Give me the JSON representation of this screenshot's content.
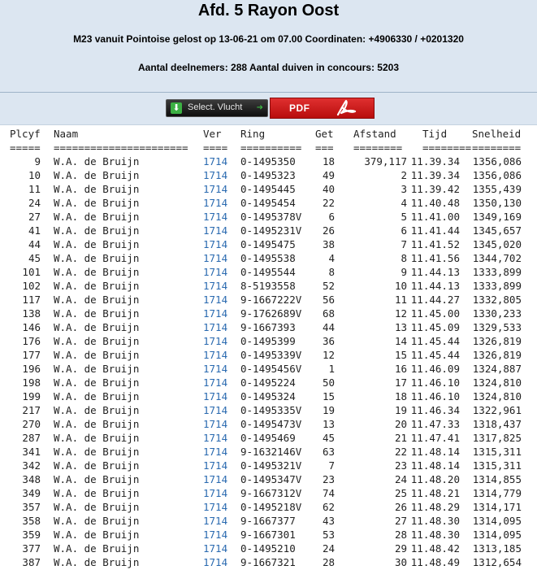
{
  "header": {
    "title": "Afd. 5 Rayon Oost",
    "subtitle": "M23 vanuit Pointoise gelost op 13-06-21 om 07.00 Coordinaten: +4906330 / +0201320",
    "participants": "Aantal deelnemers: 288 Aantal duiven in concours: 5203"
  },
  "toolbar": {
    "select_label": "Select. Vlucht",
    "pdf_label": "PDF",
    "select_icon": "download-icon",
    "pdf_icon": "adobe-acrobat-icon"
  },
  "colors": {
    "header_bg": "#dce6f1",
    "link": "#2a6ab0",
    "pdf_red": "#d01f1f"
  },
  "columns": [
    "Plcyf",
    "Naam",
    "Ver",
    "Ring",
    "Get",
    "Afstand",
    "Tijd",
    "Snelheid"
  ],
  "separators": [
    "=====",
    "======================",
    "====",
    "==========",
    "===",
    "========",
    "========",
    "========"
  ],
  "rows": [
    [
      "9",
      "W.A. de Bruijn",
      "1714",
      "0-1495350",
      "18",
      "379,117",
      "11.39.34",
      "1356,086"
    ],
    [
      "10",
      "W.A. de Bruijn",
      "1714",
      "0-1495323",
      "49",
      "2",
      "11.39.34",
      "1356,086"
    ],
    [
      "11",
      "W.A. de Bruijn",
      "1714",
      "0-1495445",
      "40",
      "3",
      "11.39.42",
      "1355,439"
    ],
    [
      "24",
      "W.A. de Bruijn",
      "1714",
      "0-1495454",
      "22",
      "4",
      "11.40.48",
      "1350,130"
    ],
    [
      "27",
      "W.A. de Bruijn",
      "1714",
      "0-1495378V",
      "6",
      "5",
      "11.41.00",
      "1349,169"
    ],
    [
      "41",
      "W.A. de Bruijn",
      "1714",
      "0-1495231V",
      "26",
      "6",
      "11.41.44",
      "1345,657"
    ],
    [
      "44",
      "W.A. de Bruijn",
      "1714",
      "0-1495475",
      "38",
      "7",
      "11.41.52",
      "1345,020"
    ],
    [
      "45",
      "W.A. de Bruijn",
      "1714",
      "0-1495538",
      "4",
      "8",
      "11.41.56",
      "1344,702"
    ],
    [
      "101",
      "W.A. de Bruijn",
      "1714",
      "0-1495544",
      "8",
      "9",
      "11.44.13",
      "1333,899"
    ],
    [
      "102",
      "W.A. de Bruijn",
      "1714",
      "8-5193558",
      "52",
      "10",
      "11.44.13",
      "1333,899"
    ],
    [
      "117",
      "W.A. de Bruijn",
      "1714",
      "9-1667222V",
      "56",
      "11",
      "11.44.27",
      "1332,805"
    ],
    [
      "138",
      "W.A. de Bruijn",
      "1714",
      "9-1762689V",
      "68",
      "12",
      "11.45.00",
      "1330,233"
    ],
    [
      "146",
      "W.A. de Bruijn",
      "1714",
      "9-1667393",
      "44",
      "13",
      "11.45.09",
      "1329,533"
    ],
    [
      "176",
      "W.A. de Bruijn",
      "1714",
      "0-1495399",
      "36",
      "14",
      "11.45.44",
      "1326,819"
    ],
    [
      "177",
      "W.A. de Bruijn",
      "1714",
      "0-1495339V",
      "12",
      "15",
      "11.45.44",
      "1326,819"
    ],
    [
      "196",
      "W.A. de Bruijn",
      "1714",
      "0-1495456V",
      "1",
      "16",
      "11.46.09",
      "1324,887"
    ],
    [
      "198",
      "W.A. de Bruijn",
      "1714",
      "0-1495224",
      "50",
      "17",
      "11.46.10",
      "1324,810"
    ],
    [
      "199",
      "W.A. de Bruijn",
      "1714",
      "0-1495324",
      "15",
      "18",
      "11.46.10",
      "1324,810"
    ],
    [
      "217",
      "W.A. de Bruijn",
      "1714",
      "0-1495335V",
      "19",
      "19",
      "11.46.34",
      "1322,961"
    ],
    [
      "270",
      "W.A. de Bruijn",
      "1714",
      "0-1495473V",
      "13",
      "20",
      "11.47.33",
      "1318,437"
    ],
    [
      "287",
      "W.A. de Bruijn",
      "1714",
      "0-1495469",
      "45",
      "21",
      "11.47.41",
      "1317,825"
    ],
    [
      "341",
      "W.A. de Bruijn",
      "1714",
      "9-1632146V",
      "63",
      "22",
      "11.48.14",
      "1315,311"
    ],
    [
      "342",
      "W.A. de Bruijn",
      "1714",
      "0-1495321V",
      "7",
      "23",
      "11.48.14",
      "1315,311"
    ],
    [
      "348",
      "W.A. de Bruijn",
      "1714",
      "0-1495347V",
      "23",
      "24",
      "11.48.20",
      "1314,855"
    ],
    [
      "349",
      "W.A. de Bruijn",
      "1714",
      "9-1667312V",
      "74",
      "25",
      "11.48.21",
      "1314,779"
    ],
    [
      "357",
      "W.A. de Bruijn",
      "1714",
      "0-1495218V",
      "62",
      "26",
      "11.48.29",
      "1314,171"
    ],
    [
      "358",
      "W.A. de Bruijn",
      "1714",
      "9-1667377",
      "43",
      "27",
      "11.48.30",
      "1314,095"
    ],
    [
      "359",
      "W.A. de Bruijn",
      "1714",
      "9-1667301",
      "53",
      "28",
      "11.48.30",
      "1314,095"
    ],
    [
      "377",
      "W.A. de Bruijn",
      "1714",
      "0-1495210",
      "24",
      "29",
      "11.48.42",
      "1313,185"
    ],
    [
      "387",
      "W.A. de Bruijn",
      "1714",
      "9-1667321",
      "28",
      "30",
      "11.48.49",
      "1312,654"
    ]
  ]
}
